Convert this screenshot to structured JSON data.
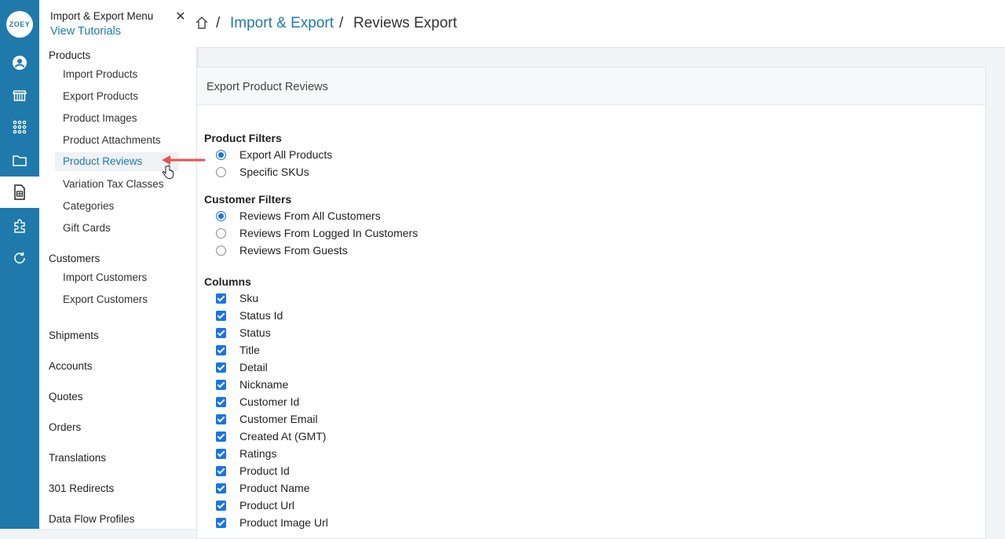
{
  "rail": {
    "logo_text": "ZOEY",
    "icons": [
      "user-icon",
      "storefront-icon",
      "apps-grid-icon",
      "folder-icon",
      "spreadsheet-icon",
      "puzzle-icon",
      "sync-icon"
    ]
  },
  "menu": {
    "title": "Import & Export Menu",
    "tutorials": "View Tutorials",
    "close": "✕",
    "products_header": "Products",
    "products_items": [
      "Import Products",
      "Export Products",
      "Product Images",
      "Product Attachments",
      "Product Reviews",
      "Variation Tax Classes",
      "Categories",
      "Gift Cards"
    ],
    "active_item": "Product Reviews",
    "customers_header": "Customers",
    "customers_items": [
      "Import Customers",
      "Export Customers"
    ],
    "other_items": [
      "Shipments",
      "Accounts",
      "Quotes",
      "Orders",
      "Translations",
      "301 Redirects",
      "Data Flow Profiles"
    ]
  },
  "breadcrumb": {
    "sep": "/",
    "link": "Import & Export",
    "current": "Reviews Export"
  },
  "card": {
    "title": "Export Product Reviews",
    "product_filters": {
      "heading": "Product Filters",
      "options": [
        "Export All Products",
        "Specific SKUs"
      ],
      "selected": "Export All Products"
    },
    "customer_filters": {
      "heading": "Customer Filters",
      "options": [
        "Reviews From All Customers",
        "Reviews From Logged In Customers",
        "Reviews From Guests"
      ],
      "selected": "Reviews From All Customers"
    },
    "columns": {
      "heading": "Columns",
      "items": [
        "Sku",
        "Status Id",
        "Status",
        "Title",
        "Detail",
        "Nickname",
        "Customer Id",
        "Customer Email",
        "Created At (GMT)",
        "Ratings",
        "Product Id",
        "Product Name",
        "Product Url",
        "Product Image Url"
      ]
    }
  },
  "colors": {
    "brand": "#1f7aab",
    "accent": "#1a73e8",
    "annotation": "#e5534b"
  }
}
